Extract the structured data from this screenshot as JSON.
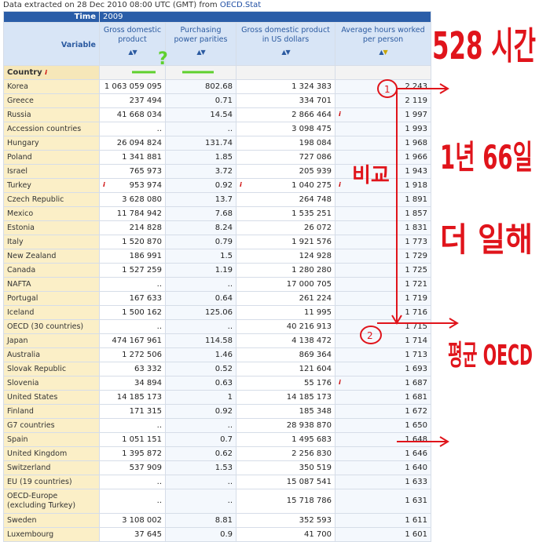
{
  "header": {
    "extracted_prefix": "Data extracted on 28 Dec 2010 08:00 UTC (GMT) from ",
    "source_link": "OECD.Stat"
  },
  "time": {
    "label": "Time",
    "value": "2009"
  },
  "variable": {
    "label": "Variable",
    "columns": [
      "Gross domestic product",
      "Purchasing power parities",
      "Gross domestic product in US dollars",
      "Average hours worked per person"
    ]
  },
  "country_header": "Country",
  "rows": [
    [
      "Korea",
      "1 063 059 095",
      "802.68",
      "1 324 383",
      "2 243"
    ],
    [
      "Greece",
      "237 494",
      "0.71",
      "334 701",
      "2 119"
    ],
    [
      "Russia",
      "41 668 034",
      "14.54",
      "2 866 464",
      "1 997"
    ],
    [
      "Accession countries",
      "..",
      "..",
      "3 098 475",
      "1 993"
    ],
    [
      "Hungary",
      "26 094 824",
      "131.74",
      "198 084",
      "1 968"
    ],
    [
      "Poland",
      "1 341 881",
      "1.85",
      "727 086",
      "1 966"
    ],
    [
      "Israel",
      "765 973",
      "3.72",
      "205 939",
      "1 943"
    ],
    [
      "Turkey",
      "953 974",
      "0.92",
      "1 040 275",
      "1 918"
    ],
    [
      "Czech Republic",
      "3 628 080",
      "13.7",
      "264 748",
      "1 891"
    ],
    [
      "Mexico",
      "11 784 942",
      "7.68",
      "1 535 251",
      "1 857"
    ],
    [
      "Estonia",
      "214 828",
      "8.24",
      "26 072",
      "1 831"
    ],
    [
      "Italy",
      "1 520 870",
      "0.79",
      "1 921 576",
      "1 773"
    ],
    [
      "New Zealand",
      "186 991",
      "1.5",
      "124 928",
      "1 729"
    ],
    [
      "Canada",
      "1 527 259",
      "1.19",
      "1 280 280",
      "1 725"
    ],
    [
      "NAFTA",
      "..",
      "..",
      "17 000 705",
      "1 721"
    ],
    [
      "Portugal",
      "167 633",
      "0.64",
      "261 224",
      "1 719"
    ],
    [
      "Iceland",
      "1 500 162",
      "125.06",
      "11 995",
      "1 716"
    ],
    [
      "OECD (30 countries)",
      "..",
      "..",
      "40 216 913",
      "1 715"
    ],
    [
      "Japan",
      "474 167 961",
      "114.58",
      "4 138 472",
      "1 714"
    ],
    [
      "Australia",
      "1 272 506",
      "1.46",
      "869 364",
      "1 713"
    ],
    [
      "Slovak Republic",
      "63 332",
      "0.52",
      "121 604",
      "1 693"
    ],
    [
      "Slovenia",
      "34 894",
      "0.63",
      "55 176",
      "1 687"
    ],
    [
      "United States",
      "14 185 173",
      "1",
      "14 185 173",
      "1 681"
    ],
    [
      "Finland",
      "171 315",
      "0.92",
      "185 348",
      "1 672"
    ],
    [
      "G7 countries",
      "..",
      "..",
      "28 938 870",
      "1 650"
    ],
    [
      "Spain",
      "1 051 151",
      "0.7",
      "1 495 683",
      "1 648"
    ],
    [
      "United Kingdom",
      "1 395 872",
      "0.62",
      "2 256 830",
      "1 646"
    ],
    [
      "Switzerland",
      "537 909",
      "1.53",
      "350 519",
      "1 640"
    ],
    [
      "EU (19 countries)",
      "..",
      "..",
      "15 087 541",
      "1 633"
    ],
    [
      "OECD-Europe (excluding Turkey)",
      "..",
      "..",
      "15 718 786",
      "1 631"
    ],
    [
      "Sweden",
      "3 108 002",
      "8.81",
      "352 593",
      "1 611"
    ],
    [
      "Luxembourg",
      "37 645",
      "0.9",
      "41 700",
      "1 601"
    ]
  ],
  "flag_glyph": "i",
  "annotations": {
    "hours": "528 시간",
    "days": "1년 66일",
    "more": "더 일해",
    "compare": "비교",
    "avg": "평균 OECD",
    "circle1": "1",
    "circle2": "2",
    "question": "?"
  },
  "colors": {
    "annotation_red": "#e0141b",
    "annotation_green": "#5fd02e",
    "header_blue": "#2a5da8"
  }
}
